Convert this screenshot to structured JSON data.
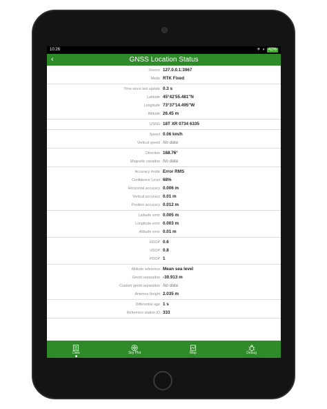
{
  "status_bar": {
    "time": "10:26",
    "battery": "42%"
  },
  "header": {
    "back_icon": "chevron-left-icon",
    "title": "GNSS Location Status"
  },
  "groups": [
    {
      "rows": [
        {
          "label": "Source",
          "value": "127.0.0.1:3967",
          "muted": false
        },
        {
          "label": "Mode",
          "value": "RTK Fixed",
          "muted": false
        }
      ]
    },
    {
      "rows": [
        {
          "label": "Time since last update",
          "value": "0.3 s",
          "muted": false
        },
        {
          "label": "Latitude",
          "value": "45°42'55.481\"N",
          "muted": false
        },
        {
          "label": "Longitude",
          "value": "73°37'14.495\"W",
          "muted": false
        },
        {
          "label": "Altitude",
          "value": "26.45 m",
          "muted": false
        }
      ]
    },
    {
      "rows": [
        {
          "label": "USNG",
          "value": "18T XR 0734 6335",
          "muted": false
        }
      ]
    },
    {
      "rows": [
        {
          "label": "Speed",
          "value": "0.06 km/h",
          "muted": false
        },
        {
          "label": "Vertical speed",
          "value": "No data",
          "muted": true
        }
      ]
    },
    {
      "rows": [
        {
          "label": "Direction",
          "value": "168.76°",
          "muted": false
        },
        {
          "label": "Magnetic variation",
          "value": "No data",
          "muted": true
        }
      ]
    },
    {
      "rows": [
        {
          "label": "Accuracy mode",
          "value": "Error RMS",
          "muted": false
        },
        {
          "label": "Confidence Level",
          "value": "68%",
          "muted": false
        },
        {
          "label": "Horizontal accuracy",
          "value": "0.006 m",
          "muted": false
        },
        {
          "label": "Vertical accuracy",
          "value": "0.01 m",
          "muted": false
        },
        {
          "label": "Position accuracy",
          "value": "0.012 m",
          "muted": false
        }
      ]
    },
    {
      "rows": [
        {
          "label": "Latitude error",
          "value": "0.005 m",
          "muted": false
        },
        {
          "label": "Longitude error",
          "value": "0.003 m",
          "muted": false
        },
        {
          "label": "Altitude error",
          "value": "0.01 m",
          "muted": false
        }
      ]
    },
    {
      "rows": [
        {
          "label": "HDOP",
          "value": "0.6",
          "muted": false
        },
        {
          "label": "VDOP",
          "value": "0.8",
          "muted": false
        },
        {
          "label": "PDOP",
          "value": "1",
          "muted": false
        }
      ]
    },
    {
      "rows": [
        {
          "label": "Altitude reference",
          "value": "Mean sea level",
          "muted": false
        },
        {
          "label": "Geoid separation",
          "value": "-30.913 m",
          "muted": false
        },
        {
          "label": "Custom geoid separation",
          "value": "No data",
          "muted": true
        },
        {
          "label": "Antenna Height",
          "value": "2.035 m",
          "muted": false
        }
      ]
    },
    {
      "rows": [
        {
          "label": "Differential age",
          "value": "1 s",
          "muted": false
        },
        {
          "label": "Reference station ID",
          "value": "333",
          "muted": false
        }
      ]
    }
  ],
  "tabs": [
    {
      "label": "Data",
      "icon": "list-icon",
      "active": true
    },
    {
      "label": "Sky Plot",
      "icon": "compass-icon",
      "active": false
    },
    {
      "label": "Map",
      "icon": "map-icon",
      "active": false
    },
    {
      "label": "Debug",
      "icon": "bug-icon",
      "active": false
    }
  ],
  "colors": {
    "accent": "#2f8a2a",
    "device": "#141414"
  }
}
